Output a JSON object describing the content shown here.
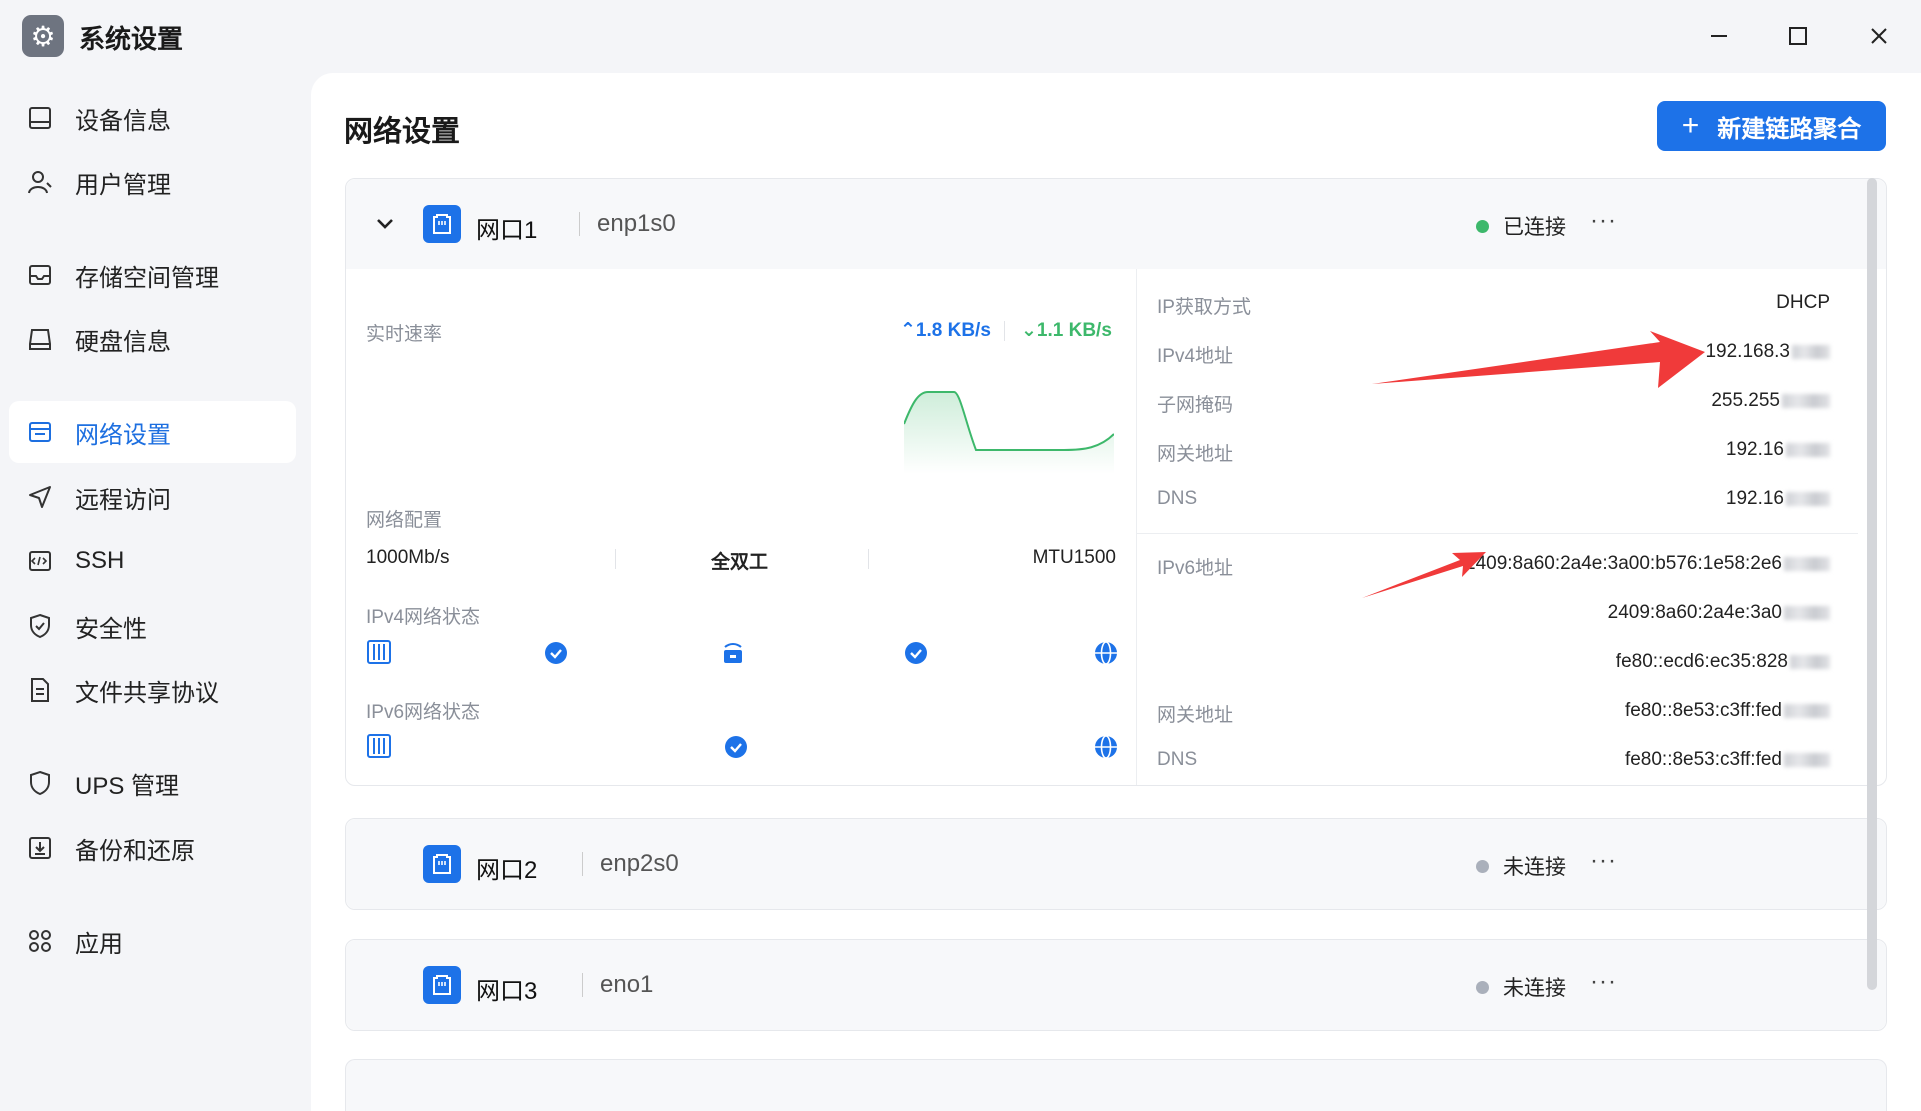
{
  "app": {
    "title": "系统设置"
  },
  "sidebar": {
    "items": [
      {
        "label": "设备信息",
        "icon": "device-icon"
      },
      {
        "label": "用户管理",
        "icon": "user-icon"
      },
      {
        "label": "存储空间管理",
        "icon": "storage-icon"
      },
      {
        "label": "硬盘信息",
        "icon": "disk-icon"
      },
      {
        "label": "网络设置",
        "icon": "network-icon"
      },
      {
        "label": "远程访问",
        "icon": "send-icon"
      },
      {
        "label": "SSH",
        "icon": "terminal-icon"
      },
      {
        "label": "安全性",
        "icon": "shield-icon"
      },
      {
        "label": "文件共享协议",
        "icon": "file-icon"
      },
      {
        "label": "UPS 管理",
        "icon": "ups-shield-icon"
      },
      {
        "label": "备份和还原",
        "icon": "backup-icon"
      },
      {
        "label": "应用",
        "icon": "apps-icon"
      }
    ],
    "active": "网络设置"
  },
  "main": {
    "title": "网络设置",
    "new_button": "新建链路聚合",
    "ports": [
      {
        "name": "网口1",
        "iface": "enp1s0",
        "status": "已连接",
        "status_color": "#3db86b",
        "expanded": true,
        "speed_label": "实时速率",
        "upload": "1.8 KB/s",
        "download": "1.1 KB/s",
        "net_config_label": "网络配置",
        "link_speed": "1000Mb/s",
        "duplex": "全双工",
        "mtu": "MTU1500",
        "ipv4_status_label": "IPv4网络状态",
        "ipv6_status_label": "IPv6网络状态",
        "ipv4": [
          {
            "label": "IP获取方式",
            "value": "DHCP"
          },
          {
            "label": "IPv4地址",
            "value": "192.168.3"
          },
          {
            "label": "子网掩码",
            "value": "255.255"
          },
          {
            "label": "网关地址",
            "value": "192.16"
          },
          {
            "label": "DNS",
            "value": "192.16"
          }
        ],
        "ipv6": {
          "label": "IPv6地址",
          "addresses": [
            "2409:8a60:2a4e:3a00:b576:1e58:2e6",
            "2409:8a60:2a4e:3a0",
            "fe80::ecd6:ec35:828"
          ],
          "gateway_label": "网关地址",
          "gateway": "fe80::8e53:c3ff:fed",
          "dns_label": "DNS",
          "dns": "fe80::8e53:c3ff:fed"
        }
      },
      {
        "name": "网口2",
        "iface": "enp2s0",
        "status": "未连接",
        "status_color": "#aab0bb",
        "expanded": false
      },
      {
        "name": "网口3",
        "iface": "eno1",
        "status": "未连接",
        "status_color": "#aab0bb",
        "expanded": false
      }
    ]
  },
  "colors": {
    "accent": "#1d72e8",
    "upload": "#1d72e8",
    "download": "#3db86b",
    "annotation": "#f03a3a"
  }
}
